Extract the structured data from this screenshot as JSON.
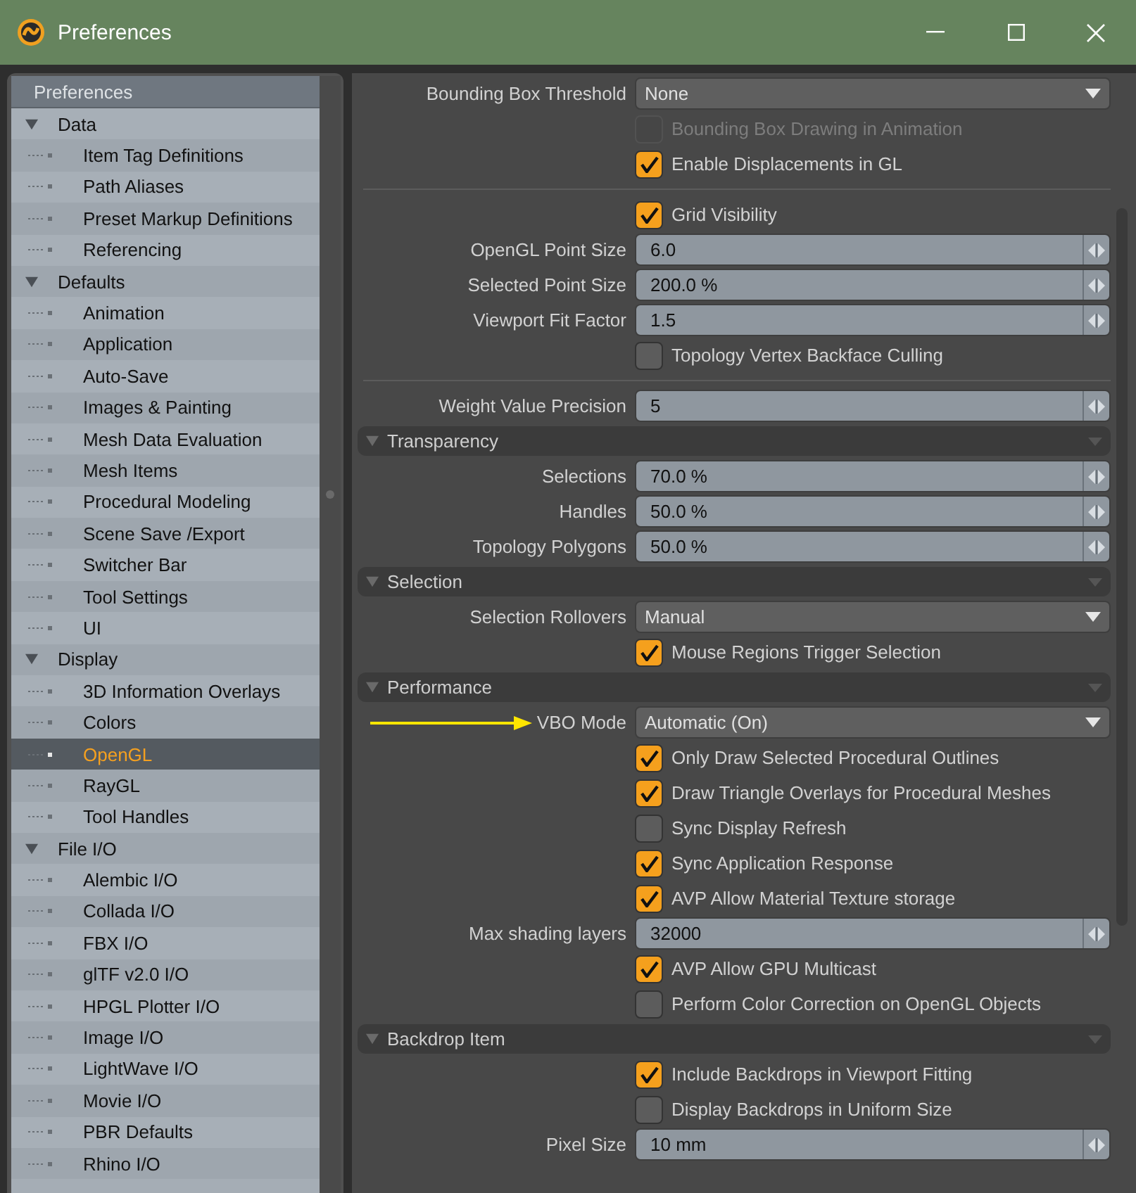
{
  "window": {
    "title": "Preferences"
  },
  "sidebar": {
    "header": "Preferences",
    "tree": [
      {
        "label": "Data",
        "expanded": true,
        "selected": false,
        "children": [
          {
            "label": "Item Tag Definitions",
            "selected": false
          },
          {
            "label": "Path Aliases",
            "selected": false
          },
          {
            "label": "Preset Markup Definitions",
            "selected": false
          },
          {
            "label": "Referencing",
            "selected": false
          }
        ]
      },
      {
        "label": "Defaults",
        "expanded": true,
        "selected": false,
        "children": [
          {
            "label": "Animation",
            "selected": false
          },
          {
            "label": "Application",
            "selected": false
          },
          {
            "label": "Auto-Save",
            "selected": false
          },
          {
            "label": "Images & Painting",
            "selected": false
          },
          {
            "label": "Mesh Data Evaluation",
            "selected": false
          },
          {
            "label": "Mesh Items",
            "selected": false
          },
          {
            "label": "Procedural Modeling",
            "selected": false
          },
          {
            "label": "Scene Save /Export",
            "selected": false
          },
          {
            "label": "Switcher Bar",
            "selected": false
          },
          {
            "label": "Tool Settings",
            "selected": false
          },
          {
            "label": "UI",
            "selected": false
          }
        ]
      },
      {
        "label": "Display",
        "expanded": true,
        "selected": false,
        "children": [
          {
            "label": "3D Information Overlays",
            "selected": false
          },
          {
            "label": "Colors",
            "selected": false
          },
          {
            "label": "OpenGL",
            "selected": true
          },
          {
            "label": "RayGL",
            "selected": false
          },
          {
            "label": "Tool Handles",
            "selected": false
          }
        ]
      },
      {
        "label": "File I/O",
        "expanded": true,
        "selected": false,
        "children": [
          {
            "label": "Alembic I/O",
            "selected": false
          },
          {
            "label": "Collada I/O",
            "selected": false
          },
          {
            "label": "FBX I/O",
            "selected": false
          },
          {
            "label": "glTF v2.0 I/O",
            "selected": false
          },
          {
            "label": "HPGL Plotter I/O",
            "selected": false
          },
          {
            "label": "Image I/O",
            "selected": false
          },
          {
            "label": "LightWave I/O",
            "selected": false
          },
          {
            "label": "Movie I/O",
            "selected": false
          },
          {
            "label": "PBR Defaults",
            "selected": false
          },
          {
            "label": "Rhino I/O",
            "selected": false
          }
        ]
      }
    ]
  },
  "settings": [
    {
      "kind": "dropdown",
      "label": "Bounding Box Threshold",
      "value": "None",
      "arrow": false
    },
    {
      "kind": "checkbox",
      "label": "Bounding Box Drawing in Animation",
      "checked": false,
      "disabled": true
    },
    {
      "kind": "checkbox",
      "label": "Enable Displacements in GL",
      "checked": true,
      "disabled": false
    },
    {
      "kind": "divider"
    },
    {
      "kind": "checkbox",
      "label": "Grid Visibility",
      "checked": true,
      "disabled": false
    },
    {
      "kind": "number",
      "label": "OpenGL Point Size",
      "value": "6.0"
    },
    {
      "kind": "number",
      "label": "Selected Point Size",
      "value": "200.0 %"
    },
    {
      "kind": "number",
      "label": "Viewport Fit Factor",
      "value": "1.5"
    },
    {
      "kind": "checkbox",
      "label": "Topology Vertex Backface Culling",
      "checked": false,
      "disabled": false
    },
    {
      "kind": "divider"
    },
    {
      "kind": "number",
      "label": "Weight Value Precision",
      "value": "5"
    },
    {
      "kind": "section",
      "title": "Transparency",
      "expanded": true
    },
    {
      "kind": "number",
      "label": "Selections",
      "value": "70.0 %"
    },
    {
      "kind": "number",
      "label": "Handles",
      "value": "50.0 %"
    },
    {
      "kind": "number",
      "label": "Topology Polygons",
      "value": "50.0 %"
    },
    {
      "kind": "section",
      "title": "Selection",
      "expanded": true
    },
    {
      "kind": "dropdown",
      "label": "Selection Rollovers",
      "value": "Manual",
      "arrow": false
    },
    {
      "kind": "checkbox",
      "label": "Mouse Regions Trigger Selection",
      "checked": true,
      "disabled": false
    },
    {
      "kind": "section",
      "title": "Performance",
      "expanded": true
    },
    {
      "kind": "dropdown",
      "label": "VBO Mode",
      "value": "Automatic (On)",
      "arrow": true
    },
    {
      "kind": "checkbox",
      "label": "Only Draw Selected Procedural Outlines",
      "checked": true,
      "disabled": false
    },
    {
      "kind": "checkbox",
      "label": "Draw Triangle Overlays for Procedural Meshes",
      "checked": true,
      "disabled": false
    },
    {
      "kind": "checkbox",
      "label": "Sync Display Refresh",
      "checked": false,
      "disabled": false
    },
    {
      "kind": "checkbox",
      "label": "Sync Application Response",
      "checked": true,
      "disabled": false
    },
    {
      "kind": "checkbox",
      "label": "AVP Allow Material Texture storage",
      "checked": true,
      "disabled": false
    },
    {
      "kind": "number",
      "label": "Max shading layers",
      "value": "32000"
    },
    {
      "kind": "checkbox",
      "label": "AVP Allow GPU Multicast",
      "checked": true,
      "disabled": false
    },
    {
      "kind": "checkbox",
      "label": "Perform Color Correction on OpenGL Objects",
      "checked": false,
      "disabled": false
    },
    {
      "kind": "section",
      "title": "Backdrop Item",
      "expanded": true
    },
    {
      "kind": "checkbox",
      "label": "Include Backdrops in Viewport Fitting",
      "checked": true,
      "disabled": false
    },
    {
      "kind": "checkbox",
      "label": "Display Backdrops in Uniform Size",
      "checked": false,
      "disabled": false
    },
    {
      "kind": "number",
      "label": "Pixel Size",
      "value": "10 mm"
    }
  ]
}
